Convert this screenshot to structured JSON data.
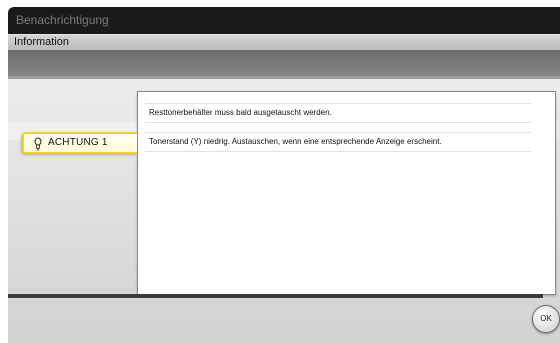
{
  "window": {
    "title": "Benachrichtigung"
  },
  "info_bar": {
    "label": "Information"
  },
  "tab": {
    "label": "ACHTUNG 1",
    "icon": "bulb-icon",
    "accent_color": "#f0d02a"
  },
  "messages": [
    "Resttonerbehälter muss bald ausgetauscht werden.",
    "Tonerstand (Y) niedrig. Austauschen, wenn eine entsprechende Anzeige erscheint."
  ],
  "actions": {
    "ok_label": "OK"
  }
}
